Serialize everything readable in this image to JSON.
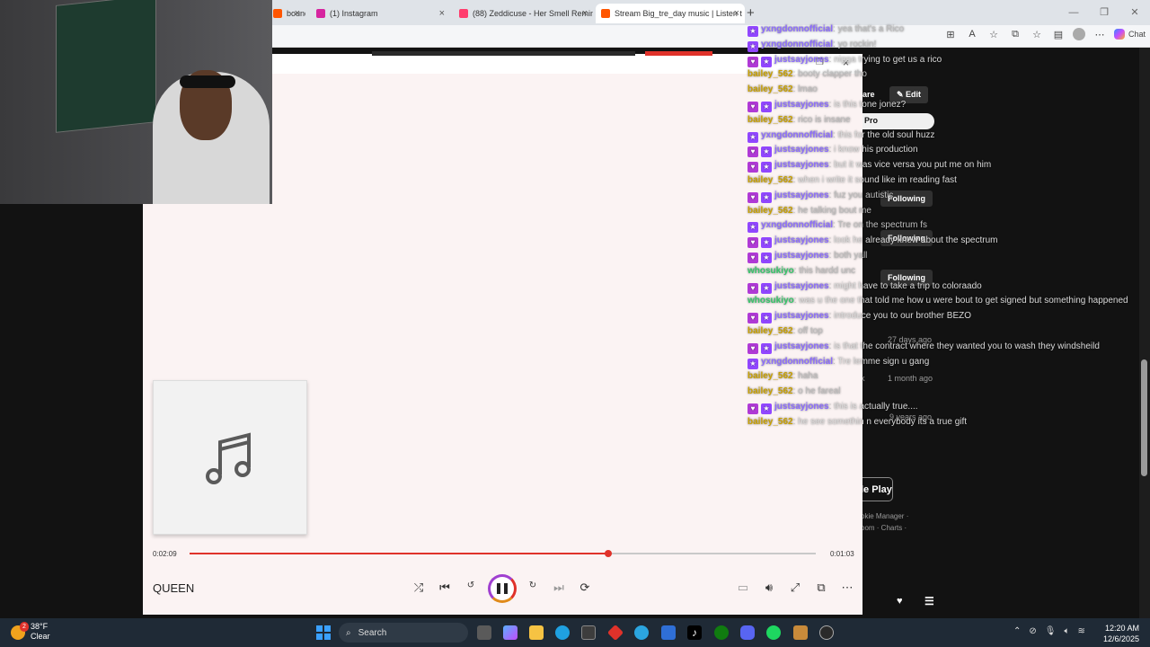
{
  "browser": {
    "tabs": [
      {
        "label": "bound V",
        "active": false,
        "color": "#ff5500"
      },
      {
        "label": "(1) Instagram",
        "active": false,
        "color": "#d6249f"
      },
      {
        "label": "(88) Zeddicuse - Her Smell Remind",
        "active": false,
        "color": "#ff3d6e"
      },
      {
        "label": "Stream Big_tre_day music | Listen t",
        "active": true,
        "color": "#ff5500"
      }
    ],
    "new_tab": "+",
    "chat_button": "Chat"
  },
  "side_buttons": {
    "share": "are",
    "edit": "Edit",
    "pro": "Pro",
    "following": [
      "Following",
      "Following",
      "Following"
    ],
    "dates": [
      "27 days ago",
      "1 month ago",
      "9 years ago"
    ],
    "letter_k": "k",
    "google_play": "le Play",
    "footer_links_1": "okie Manager ·",
    "footer_links_2": "oom · Charts ·"
  },
  "player": {
    "time_current": "0:02:09",
    "time_total": "0:01:03",
    "progress_fraction": 0.669,
    "song_title": "QUEEN",
    "cover_icon": "music-note-icon"
  },
  "chat": [
    {
      "user": "yxngdonnofficial",
      "badges": [
        "sub"
      ],
      "color": "#8c6cff",
      "message": "yea that's a Rico",
      "msgclass": "m-gray"
    },
    {
      "user": "yxngdonnofficial",
      "badges": [
        "sub"
      ],
      "color": "#8c6cff",
      "message": "yo rockin!",
      "msgclass": "m-gray"
    },
    {
      "user": "justsayjones",
      "badges": [
        "heart",
        "sub"
      ],
      "color": "#8c6cff",
      "message": "nigga trying to get us a rico",
      "msgclass": "m-dark"
    },
    {
      "user": "bailey_562",
      "badges": [],
      "color": "#c8a000",
      "message": "booty clapper tho",
      "msgclass": "m-gray"
    },
    {
      "user": "bailey_562",
      "badges": [],
      "color": "#c8a000",
      "message": "lmao",
      "msgclass": "m-gray"
    },
    {
      "user": "justsayjones",
      "badges": [
        "heart",
        "sub"
      ],
      "color": "#8c6cff",
      "message": "is this tone jonez?",
      "msgclass": "m-dark"
    },
    {
      "user": "bailey_562",
      "badges": [],
      "color": "#c8a000",
      "message": "rico is insane",
      "msgclass": "m-gray"
    },
    {
      "user": "yxngdonnofficial",
      "badges": [
        "sub"
      ],
      "color": "#8c6cff",
      "message": "this for the old soul huzz",
      "msgclass": "m-dark"
    },
    {
      "user": "justsayjones",
      "badges": [
        "heart",
        "sub"
      ],
      "color": "#8c6cff",
      "message": "i know his production",
      "msgclass": "m-dark"
    },
    {
      "user": "justsayjones",
      "badges": [
        "heart",
        "sub"
      ],
      "color": "#8c6cff",
      "message": "but it was vice versa you put me on him",
      "msgclass": "m-dark"
    },
    {
      "user": "bailey_562",
      "badges": [],
      "color": "#c8a000",
      "message": "when i write it sound like im reading fast",
      "msgclass": "m-dark"
    },
    {
      "user": "justsayjones",
      "badges": [
        "heart",
        "sub"
      ],
      "color": "#8c6cff",
      "message": "fuz you autistic",
      "msgclass": "m-gray"
    },
    {
      "user": "bailey_562",
      "badges": [],
      "color": "#c8a000",
      "message": "he talking bout me",
      "msgclass": "m-gray"
    },
    {
      "user": "yxngdonnofficial",
      "badges": [
        "sub"
      ],
      "color": "#8c6cff",
      "message": "Tre on the spectrum fs",
      "msgclass": "m-gray"
    },
    {
      "user": "justsayjones",
      "badges": [
        "heart",
        "sub"
      ],
      "color": "#8c6cff",
      "message": "look he already knew about the spectrum",
      "msgclass": "m-dark"
    },
    {
      "user": "justsayjones",
      "badges": [
        "heart",
        "sub"
      ],
      "color": "#8c6cff",
      "message": "both yall",
      "msgclass": "m-gray"
    },
    {
      "user": "whosukiyo",
      "badges": [],
      "color": "#36c66a",
      "message": "this hardd unc",
      "msgclass": "m-gray"
    },
    {
      "user": "justsayjones",
      "badges": [
        "heart",
        "sub"
      ],
      "color": "#8c6cff",
      "message": "might have to take a trip to coloraado",
      "msgclass": "m-dark"
    },
    {
      "user": "whosukiyo",
      "badges": [],
      "color": "#36c66a",
      "message": "was u the one that told me how u were bout to get signed but something happened",
      "msgclass": "m-dark"
    },
    {
      "user": "justsayjones",
      "badges": [
        "heart",
        "sub"
      ],
      "color": "#8c6cff",
      "message": "introduce you to our brother BEZO",
      "msgclass": "m-dark"
    },
    {
      "user": "bailey_562",
      "badges": [],
      "color": "#c8a000",
      "message": "off top",
      "msgclass": "m-gray"
    },
    {
      "user": "justsayjones",
      "badges": [
        "heart",
        "sub"
      ],
      "color": "#8c6cff",
      "message": "is that the contract where they wanted you to wash they windsheild",
      "msgclass": "m-dark"
    },
    {
      "user": "yxngdonnofficial",
      "badges": [
        "sub"
      ],
      "color": "#8c6cff",
      "message": "Tre lemme sign u gang",
      "msgclass": "m-dark"
    },
    {
      "user": "bailey_562",
      "badges": [],
      "color": "#c8a000",
      "message": "haha",
      "msgclass": "m-gray"
    },
    {
      "user": "bailey_562",
      "badges": [],
      "color": "#c8a000",
      "message": "o he fareal",
      "msgclass": "m-gray"
    },
    {
      "user": "justsayjones",
      "badges": [
        "heart",
        "sub"
      ],
      "color": "#8c6cff",
      "message": "this is actually true....",
      "msgclass": "m-dark"
    },
    {
      "user": "bailey_562",
      "badges": [],
      "color": "#c8a000",
      "message": "he see somethin n everybody its a true gift",
      "msgclass": "m-dark"
    }
  ],
  "taskbar": {
    "weather_temp": "38°F",
    "weather_desc": "Clear",
    "weather_badge": "2",
    "search_placeholder": "Search",
    "time": "12:20 AM",
    "date": "12/6/2025"
  }
}
